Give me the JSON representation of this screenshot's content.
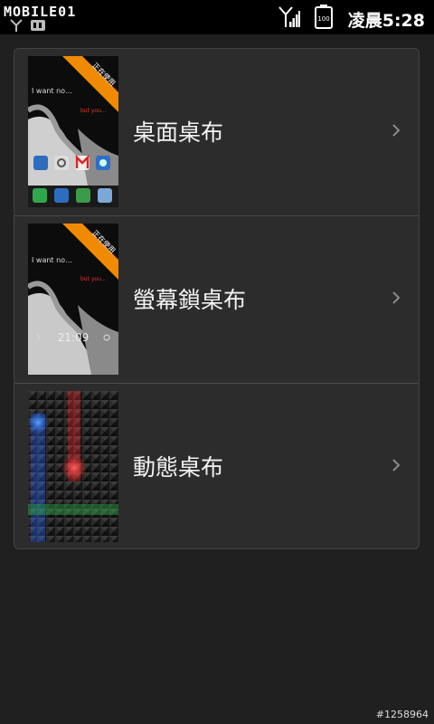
{
  "status_bar": {
    "watermark": "MOBILE01",
    "time": "凌晨5:28",
    "battery_level": "100",
    "signal_icon": "signal-bars-icon",
    "battery_icon": "battery-icon"
  },
  "wallpaper_list": {
    "items": [
      {
        "label": "桌面桌布",
        "badge": "正在使用",
        "preview_time": "",
        "icon": "chevron-right-icon"
      },
      {
        "label": "螢幕鎖桌布",
        "badge": "正在使用",
        "preview_time": "21:09",
        "icon": "chevron-right-icon"
      },
      {
        "label": "動態桌布",
        "badge": "",
        "preview_time": "",
        "icon": "chevron-right-icon"
      }
    ]
  },
  "footer": {
    "id_text": "#1258964"
  },
  "colors": {
    "background": "#202020",
    "card": "#2c2c2c",
    "badge": "#f08a00",
    "live_blue": "#2a6cff",
    "live_red": "#ff2a2a",
    "live_green": "#2ea84a"
  }
}
